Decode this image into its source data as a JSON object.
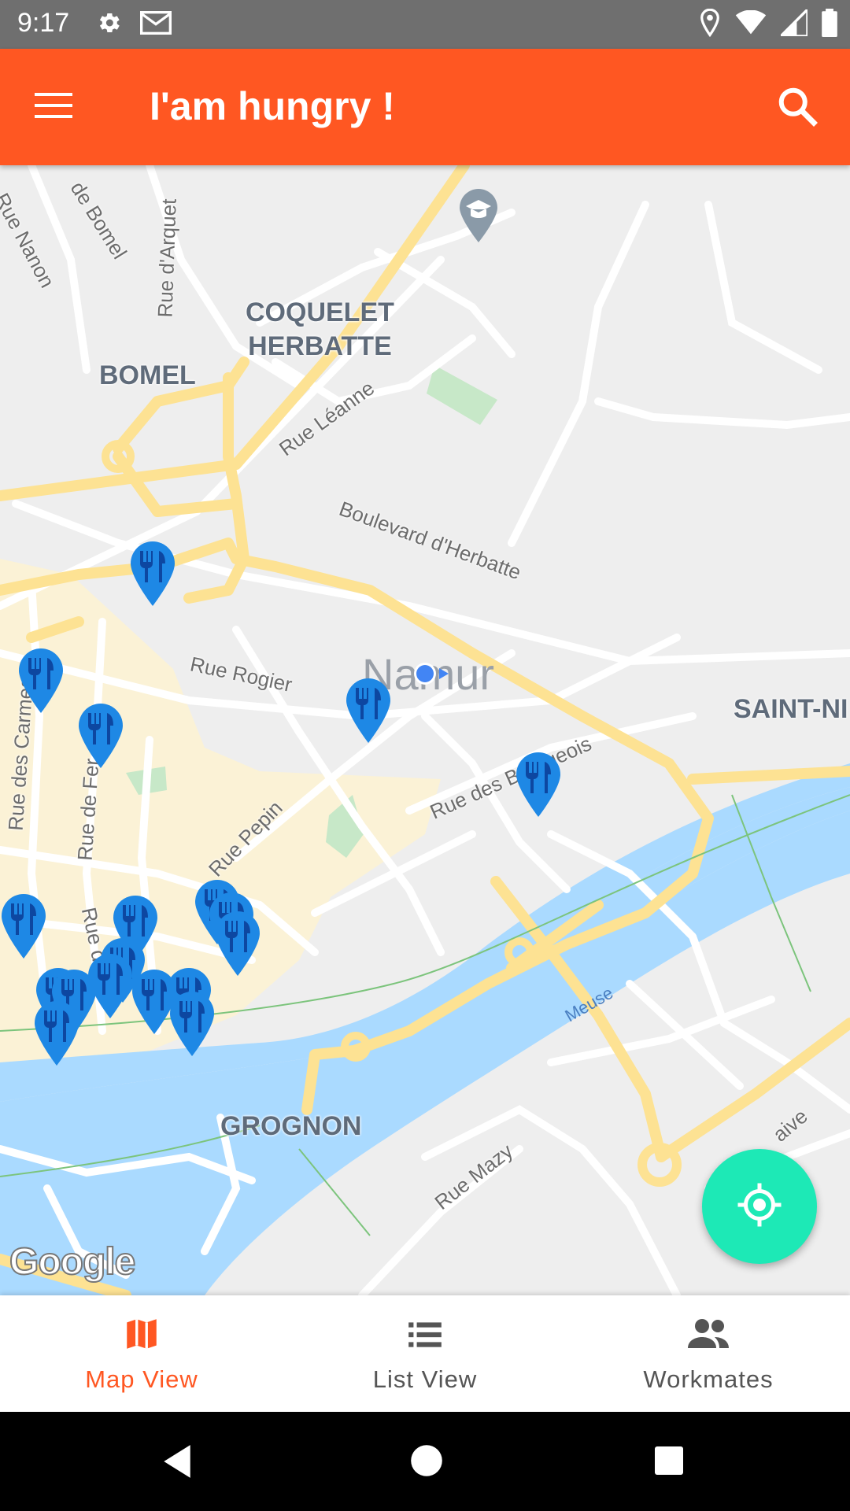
{
  "status_bar": {
    "time": "9:17",
    "left_icons": [
      "settings-icon",
      "gmail-icon"
    ],
    "right_icons": [
      "location-icon",
      "wifi-icon",
      "signal-icon",
      "battery-icon"
    ]
  },
  "app_bar": {
    "title": "I'am hungry !",
    "menu_icon": "hamburger-menu-icon",
    "search_icon": "search-icon",
    "color": "#ff5722"
  },
  "map": {
    "districts": [
      "COQUELET\nHERBATTE",
      "BOMEL",
      "SAINT-NI",
      "GROGNON"
    ],
    "city_label": "Namur",
    "streets": [
      "Rue Nanon",
      "de Bomel",
      "Rue d'Arquet",
      "Rue Léanne",
      "Boulevard d'Herbatte",
      "Rue Rogier",
      "Rue des Carmes",
      "Rue de Fer",
      "Rue Pepin",
      "Rue des Bourgeois",
      "Rue d",
      "Rue Mazy",
      "aive"
    ],
    "river": "Meuse",
    "attribution": "Google",
    "restaurant_marker_icon": "restaurant-icon",
    "restaurant_marker_color": "#1e88e5",
    "restaurant_count": 16,
    "poi_icons": [
      "school-icon"
    ],
    "my_location_color": "#4285f4"
  },
  "fab": {
    "icon": "my-location-icon",
    "color": "#1de9b6"
  },
  "bottom_nav": {
    "items": [
      {
        "label": "Map View",
        "icon": "map-icon",
        "active": true
      },
      {
        "label": "List View",
        "icon": "list-icon",
        "active": false
      },
      {
        "label": "Workmates",
        "icon": "people-icon",
        "active": false
      }
    ],
    "active_color": "#ff5722",
    "inactive_color": "#555555"
  },
  "system_nav": {
    "icons": [
      "back-icon",
      "home-icon",
      "recents-icon"
    ]
  }
}
